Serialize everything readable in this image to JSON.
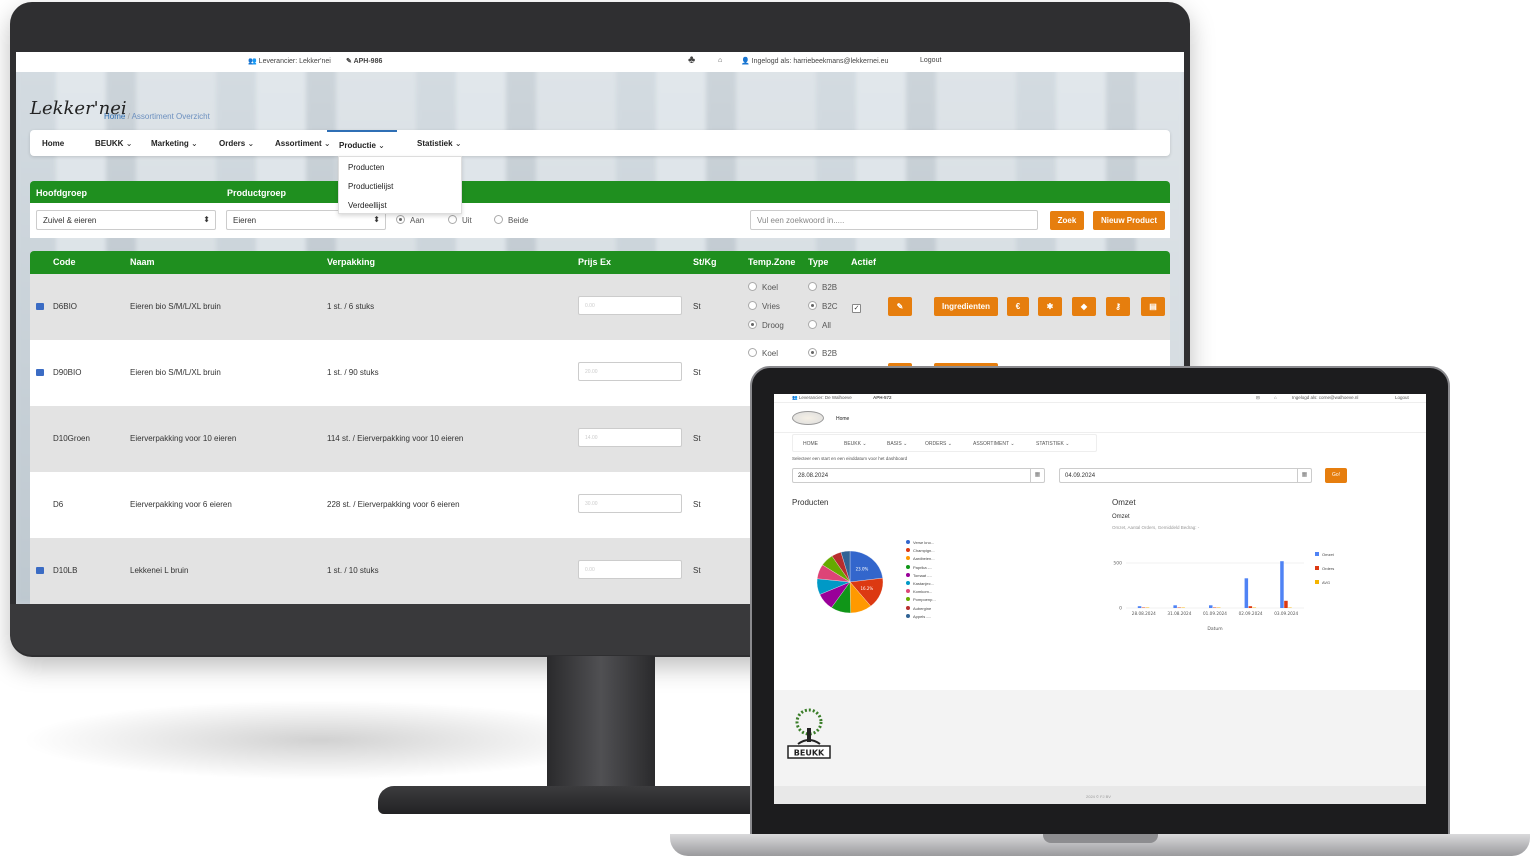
{
  "desktop": {
    "topbar": {
      "supplier": "Leverancier: Lekker'nei",
      "code": "APH-986",
      "logged_in": "Ingelogd als: harriebeekmans@lekkernei.eu",
      "logout": "Logout"
    },
    "logo_text": "Lekker'nei",
    "breadcrumb": [
      "Home",
      "Assortiment Overzicht"
    ],
    "nav": [
      "Home",
      "BEUKK",
      "Marketing",
      "Orders",
      "Assortiment",
      "Productie",
      "Statistiek"
    ],
    "dropdown": [
      "Producten",
      "Productielijst",
      "Verdeellijst"
    ],
    "filter": {
      "hoofdgroep_label": "Hoofdgroep",
      "productgroep_label": "Productgroep",
      "hoofdgroep_value": "Zuivel & eieren",
      "productgroep_value": "Eieren",
      "radio": [
        "Aan",
        "Uit",
        "Beide"
      ],
      "search_placeholder": "Vul een zoekwoord in.....",
      "search_button": "Zoek",
      "new_button": "Nieuw Product"
    },
    "table": {
      "headers": [
        "Code",
        "Naam",
        "Verpakking",
        "Prijs Ex",
        "St/Kg",
        "Temp.Zone",
        "Type",
        "Actief"
      ],
      "rows": [
        {
          "code": "D6BIO",
          "naam": "Eieren bio S/M/L/XL bruin",
          "verpakking": "1 st. / 6 stuks",
          "unit": "St",
          "prijs": "0.00"
        },
        {
          "code": "D90BIO",
          "naam": "Eieren bio S/M/L/XL bruin",
          "verpakking": "1 st. / 90 stuks",
          "unit": "St",
          "prijs": "20.00"
        },
        {
          "code": "D10Groen",
          "naam": "Eierverpakking voor 10 eieren",
          "verpakking": "114 st. / Eierverpakking voor 10 eieren",
          "unit": "St",
          "prijs": "14.00"
        },
        {
          "code": "D6",
          "naam": "Eierverpakking voor 6 eieren",
          "verpakking": "228 st. / Eierverpakking voor 6 eieren",
          "unit": "St",
          "prijs": "30.00"
        },
        {
          "code": "D10LB",
          "naam": "Lekkenei L bruin",
          "verpakking": "1 st. / 10 stuks",
          "unit": "St",
          "prijs": "0.00"
        }
      ],
      "temp_zones": [
        "Koel",
        "Vries",
        "Droog"
      ],
      "types": [
        "B2B",
        "B2C",
        "All"
      ],
      "ingredienten_button": "Ingredienten",
      "action_icons": [
        "edit-icon",
        "euro-icon",
        "asterisk-icon",
        "tag-icon",
        "key-icon",
        "file-icon"
      ]
    }
  },
  "laptop": {
    "topbar": {
      "supplier": "Leverancier: De Walhoeve",
      "code": "APH-572",
      "logged_in": "Ingelogd als: corne@walhoeve.nl",
      "logout": "Logout"
    },
    "breadcrumb": "Home",
    "nav": [
      "HOME",
      "BEUKK",
      "BASIS",
      "ORDERS",
      "ASSORTIMENT",
      "STATISTIEK"
    ],
    "date_prompt": "Selecteer een start en een einddatum voor het dashboard",
    "start_date": "28.08.2024",
    "end_date": "04.09.2024",
    "go_button": "Go!",
    "products_title": "Producten",
    "omzet_title": "Omzet",
    "omzet_subtitle": "Omzet",
    "omzet_desc": "Omzet, Aantal Orders, Gemiddeld Bedrag: -",
    "footer_logo": "BEUKK",
    "footer_text": "2024 © FJ BV"
  },
  "chart_data": [
    {
      "type": "pie",
      "title": "Producten",
      "labels": [
        "Verse kno...",
        "Champign...",
        "Aardbeien...",
        "Paprika -...",
        "Tomaat -...",
        "Kastanjec...",
        "Komkom...",
        "Pompoenp...",
        "Aubergine",
        "Appels -..."
      ],
      "values": [
        23.0,
        16.2,
        10.5,
        9.8,
        8.9,
        8.3,
        7.6,
        6.5,
        4.8,
        4.4
      ],
      "data_labels": [
        "23.0%",
        "16.2%"
      ],
      "colors": [
        "#3366cc",
        "#dc3912",
        "#ff9900",
        "#109618",
        "#990099",
        "#0099c6",
        "#dd4477",
        "#66aa00",
        "#b82e2e",
        "#316395"
      ]
    },
    {
      "type": "bar",
      "title": "Omzet",
      "categories": [
        "28.08.2024",
        "31.08.2024",
        "01.09.2024",
        "02.09.2024",
        "03.09.2024"
      ],
      "series": [
        {
          "name": "Omzet",
          "color": "#4f83f5",
          "values": [
            20,
            30,
            30,
            330,
            520
          ]
        },
        {
          "name": "Orders",
          "color": "#dc3912",
          "values": [
            5,
            5,
            5,
            20,
            80
          ]
        },
        {
          "name": "AVG",
          "color": "#f5b400",
          "values": [
            5,
            5,
            5,
            5,
            5
          ]
        }
      ],
      "xlabel": "Datum",
      "ylim": [
        0,
        600
      ],
      "yticks": [
        0,
        500
      ],
      "legend": "right"
    }
  ]
}
